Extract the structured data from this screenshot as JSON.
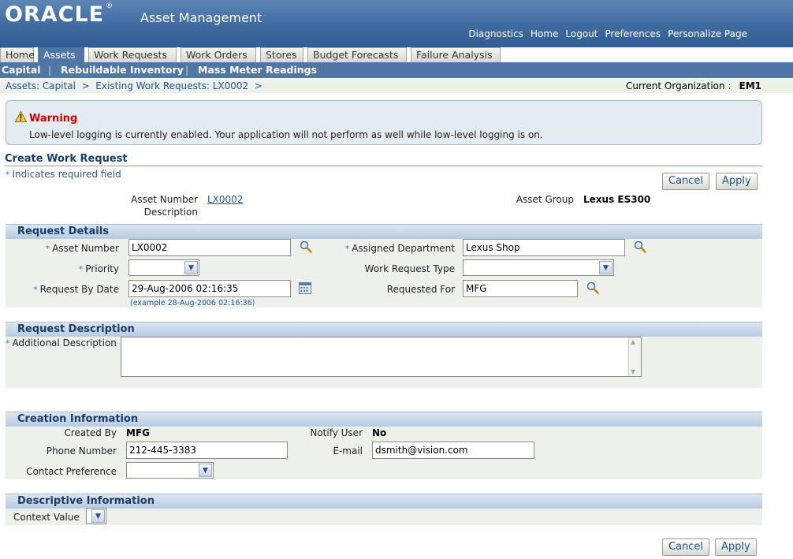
{
  "header": {
    "logo_text": "ORACLE",
    "logo_mark": "®",
    "app_title": "Asset Management",
    "global_links": [
      "Diagnostics",
      "Home",
      "Logout",
      "Preferences",
      "Personalize Page"
    ]
  },
  "tabs": [
    "Home",
    "Assets",
    "Work Requests",
    "Work Orders",
    "Stores",
    "Budget Forecasts",
    "Failure Analysis"
  ],
  "active_tab": "Assets",
  "subtabs": [
    "Capital",
    "Rebuildable Inventory",
    "Mass Meter Readings"
  ],
  "breadcrumb": "Assets: Capital  >  Existing Work Requests: LX0002  >",
  "current_org": {
    "label": "Current Organization :",
    "value": "EM1"
  },
  "warning": {
    "title": "Warning",
    "message": "Low-level logging is currently enabled. Your application will not perform as well while low-level logging is on."
  },
  "page": {
    "title": "Create Work Request",
    "required_note": "Indicates required field",
    "required_star": "*",
    "cancel_label": "Cancel",
    "apply_label": "Apply"
  },
  "asset_header": {
    "asset_number_label": "Asset Number",
    "asset_number_value": "LX0002",
    "description_label": "Description",
    "asset_group_label": "Asset Group",
    "asset_group_value": "Lexus ES300"
  },
  "request_details": {
    "title": "Request Details",
    "asset_number_label": "Asset Number",
    "asset_number_value": "LX0002",
    "priority_label": "Priority",
    "priority_value": "",
    "request_by_date_label": "Request By Date",
    "request_by_date_value": "29-Aug-2006 02:16:35",
    "date_hint": "(example 28-Aug-2006 02:16:36)",
    "assigned_department_label": "Assigned Department",
    "assigned_department_value": "Lexus Shop",
    "work_request_type_label": "Work Request Type",
    "work_request_type_value": "",
    "requested_for_label": "Requested For",
    "requested_for_value": "MFG"
  },
  "request_description": {
    "title": "Request Description",
    "additional_description_label": "Additional Description",
    "additional_description_value": ""
  },
  "creation_info": {
    "title": "Creation Information",
    "created_by_label": "Created By",
    "created_by_value": "MFG",
    "phone_label": "Phone Number",
    "phone_value": "212-445-3383",
    "contact_pref_label": "Contact Preference",
    "contact_pref_value": "",
    "notify_user_label": "Notify User",
    "notify_user_value": "No",
    "email_label": "E-mail",
    "email_value": "dsmith@vision.com"
  },
  "descriptive_info": {
    "title": "Descriptive Information",
    "context_value_label": "Context Value",
    "context_value_value": ""
  },
  "colors": {
    "header_blue": "#3e6aa0",
    "tab_active": "#5076a6",
    "link": "#22558c",
    "warning_red": "#cc0000"
  }
}
